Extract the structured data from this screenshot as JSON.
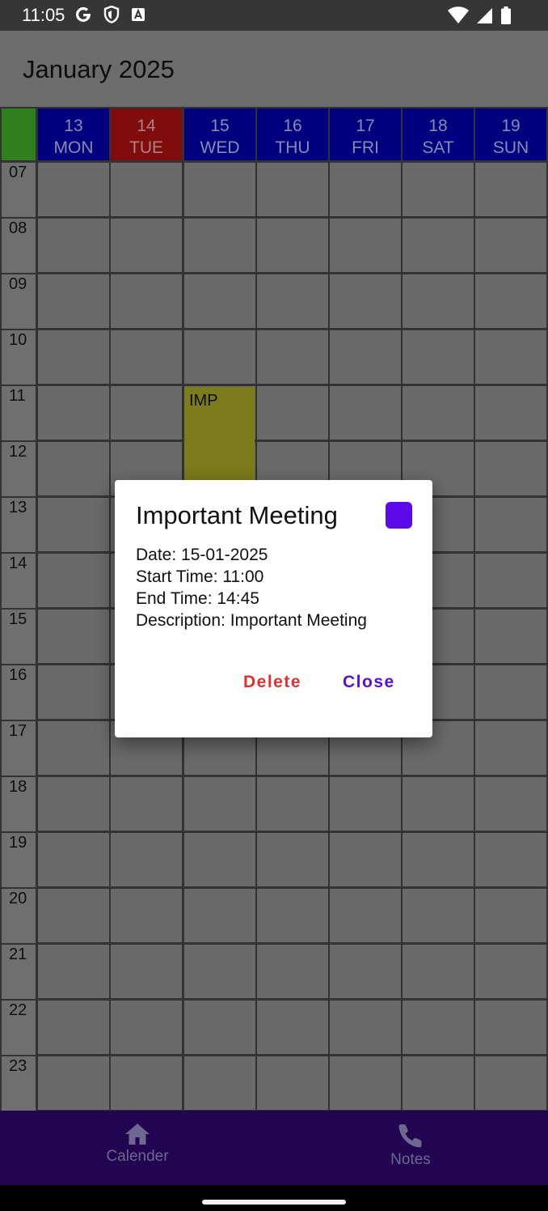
{
  "status_bar": {
    "time": "11:05",
    "icons": [
      "google-icon",
      "shield-icon",
      "text-a-icon",
      "wifi-icon",
      "signal-icon",
      "battery-icon"
    ]
  },
  "app_bar": {
    "title": "January 2025"
  },
  "calendar": {
    "days": [
      {
        "num": "13",
        "name": "MON",
        "state": "normal"
      },
      {
        "num": "14",
        "name": "TUE",
        "state": "today"
      },
      {
        "num": "15",
        "name": "WED",
        "state": "normal"
      },
      {
        "num": "16",
        "name": "THU",
        "state": "normal"
      },
      {
        "num": "17",
        "name": "FRI",
        "state": "normal"
      },
      {
        "num": "18",
        "name": "SAT",
        "state": "normal"
      },
      {
        "num": "19",
        "name": "SUN",
        "state": "normal"
      }
    ],
    "hours": [
      "07",
      "08",
      "09",
      "10",
      "11",
      "12",
      "13",
      "14",
      "15",
      "16",
      "17",
      "18",
      "19",
      "20",
      "21",
      "22",
      "23"
    ],
    "event_label": "IMP"
  },
  "dialog": {
    "title": "Important Meeting",
    "swatch_color": "#5b0bea",
    "date_line": "Date: 15-01-2025",
    "start_line": "Start Time: 11:00",
    "end_line": "End Time: 14:45",
    "description_line": "Description: Important Meeting",
    "delete_label": "Delete",
    "close_label": "Close"
  },
  "bottom_nav": {
    "items": [
      {
        "label": "Calender",
        "icon": "home-icon"
      },
      {
        "label": "Notes",
        "icon": "phone-icon"
      }
    ]
  },
  "colors": {
    "today_header": "#7f0d0d",
    "day_header": "#010180",
    "corner": "#317e1e",
    "event": "#7c7c1c",
    "nav_background": "#210452"
  }
}
